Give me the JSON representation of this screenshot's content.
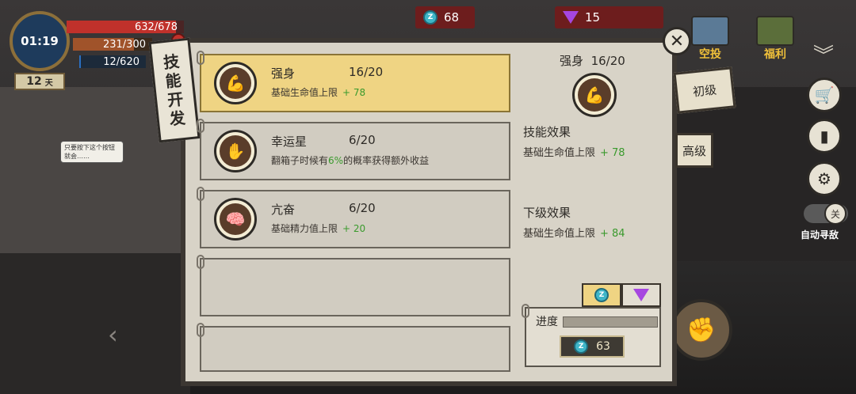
{
  "hud": {
    "time": "01:19",
    "hp": "632/678",
    "hp_fraction": 0.93,
    "hunger": "231/300",
    "hunger_fraction": 0.77,
    "water": "12/620",
    "water_fraction": 0.02,
    "day": "12",
    "day_unit": "天",
    "speech": "只要按下这个按钮就会……",
    "airdrop_label": "空投",
    "welfare_label": "福利",
    "auto_label": "自动寻敌",
    "toggle_label": "关"
  },
  "currency": {
    "z_icon": "Z",
    "z_amount": "68",
    "gem_amount": "15"
  },
  "panel": {
    "banner": [
      "技",
      "能",
      "开",
      "发"
    ],
    "tiers": {
      "basic": "初级",
      "advanced": "高级"
    },
    "skills": [
      {
        "name": "强身",
        "level": "16/20",
        "icon": "muscle-icon",
        "symbol": "💪",
        "desc_pre": "基础生命值上限",
        "desc_hl": "",
        "desc_post": "",
        "plus": "+ 78"
      },
      {
        "name": "幸运星",
        "level": "6/20",
        "icon": "lucky-hand-icon",
        "symbol": "✋",
        "desc_pre": "翻箱子时候有",
        "desc_hl": "6%",
        "desc_post": "的概率获得额外收益",
        "plus": ""
      },
      {
        "name": "亢奋",
        "level": "6/20",
        "icon": "brain-icon",
        "symbol": "🧠",
        "desc_pre": "基础精力值上限",
        "desc_hl": "",
        "desc_post": "",
        "plus": "+ 20"
      }
    ],
    "detail": {
      "title": "强身",
      "level": "16/20",
      "effect_heading": "技能效果",
      "effect_text": "基础生命值上限",
      "effect_plus": "+ 78",
      "next_heading": "下级效果",
      "next_text": "基础生命值上限",
      "next_plus": "+ 84"
    },
    "progress": {
      "label": "进度",
      "fraction": 0.0,
      "cost": "63",
      "tab_z": "Z"
    }
  },
  "colors": {
    "active_card": "#efd483",
    "positive": "#3a9a2d",
    "hp": "#c0312b",
    "hunger": "#c05a2b",
    "water": "#2b6fc0"
  }
}
